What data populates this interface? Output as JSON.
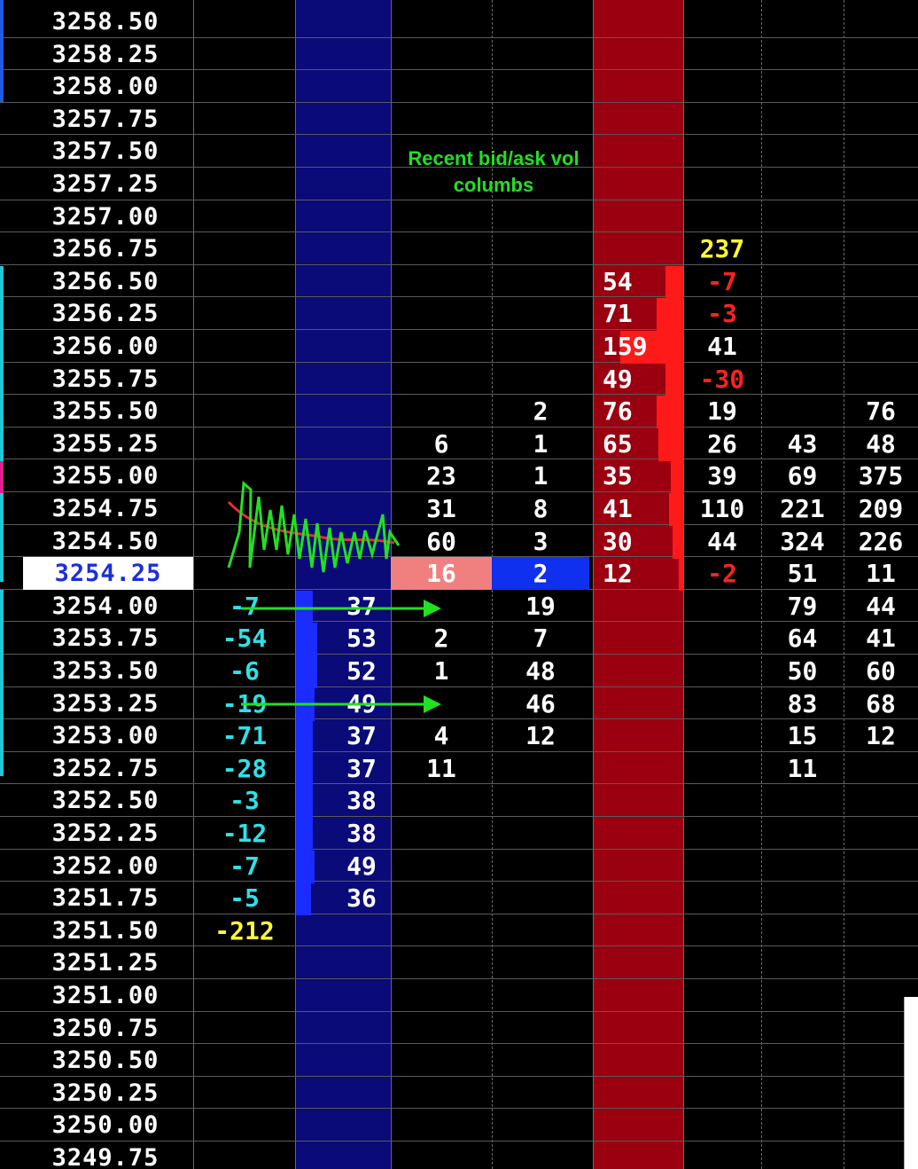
{
  "annotation": {
    "line1": "Recent bid/ask vol",
    "line2": "columbs"
  },
  "current_price": "3254.25",
  "rows": [
    {
      "price": "3258.50"
    },
    {
      "price": "3258.25"
    },
    {
      "price": "3258.00"
    },
    {
      "price": "3257.75"
    },
    {
      "price": "3257.50"
    },
    {
      "price": "3257.25"
    },
    {
      "price": "3257.00"
    },
    {
      "price": "3256.75",
      "delta_a": "237"
    },
    {
      "price": "3256.50",
      "ask": "54",
      "ask_fill": 0.2,
      "delta_a": "-7"
    },
    {
      "price": "3256.25",
      "ask": "71",
      "ask_fill": 0.3,
      "delta_a": "-3"
    },
    {
      "price": "3256.00",
      "ask": "159",
      "ask_fill": 0.7,
      "delta_a": "41"
    },
    {
      "price": "3255.75",
      "ask": "49",
      "ask_fill": 0.2,
      "delta_a": "-30"
    },
    {
      "price": "3255.50",
      "rec_ask": "2",
      "ask": "76",
      "ask_fill": 0.3,
      "delta_a": "19",
      "col_h": "76"
    },
    {
      "price": "3255.25",
      "rec_bid": "6",
      "rec_ask": "1",
      "ask": "65",
      "ask_fill": 0.28,
      "delta_a": "26",
      "col_g": "43",
      "col_h": "48"
    },
    {
      "price": "3255.00",
      "rec_bid": "23",
      "rec_ask": "1",
      "ask": "35",
      "ask_fill": 0.14,
      "delta_a": "39",
      "col_g": "69",
      "col_h": "375"
    },
    {
      "price": "3254.75",
      "rec_bid": "31",
      "rec_ask": "8",
      "ask": "41",
      "ask_fill": 0.16,
      "delta_a": "110",
      "col_g": "221",
      "col_h": "209"
    },
    {
      "price": "3254.50",
      "rec_bid": "60",
      "rec_ask": "3",
      "ask": "30",
      "ask_fill": 0.12,
      "delta_a": "44",
      "col_g": "324",
      "col_h": "226"
    },
    {
      "price": "3254.25",
      "current": true,
      "rec_bid": "16",
      "rec_ask": "2",
      "ask": "12",
      "ask_fill": 0.05,
      "delta_a": "-2",
      "col_g": "51",
      "col_h": "11"
    },
    {
      "price": "3254.00",
      "delta_b": "-7",
      "bid": "37",
      "bid_fill": 0.18,
      "rec_ask": "19",
      "col_g": "79",
      "col_h": "44"
    },
    {
      "price": "3253.75",
      "delta_b": "-54",
      "bid": "53",
      "bid_fill": 0.22,
      "rec_bid": "2",
      "rec_ask": "7",
      "col_g": "64",
      "col_h": "41"
    },
    {
      "price": "3253.50",
      "delta_b": "-6",
      "bid": "52",
      "bid_fill": 0.22,
      "rec_bid": "1",
      "rec_ask": "48",
      "col_g": "50",
      "col_h": "60"
    },
    {
      "price": "3253.25",
      "delta_b": "-19",
      "bid": "49",
      "bid_fill": 0.2,
      "rec_ask": "46",
      "col_g": "83",
      "col_h": "68"
    },
    {
      "price": "3253.00",
      "delta_b": "-71",
      "bid": "37",
      "bid_fill": 0.18,
      "rec_bid": "4",
      "rec_ask": "12",
      "col_g": "15",
      "col_h": "12"
    },
    {
      "price": "3252.75",
      "delta_b": "-28",
      "bid": "37",
      "bid_fill": 0.18,
      "rec_bid": "11",
      "col_g": "11"
    },
    {
      "price": "3252.50",
      "delta_b": "-3",
      "bid": "38",
      "bid_fill": 0.18
    },
    {
      "price": "3252.25",
      "delta_b": "-12",
      "bid": "38",
      "bid_fill": 0.18
    },
    {
      "price": "3252.00",
      "delta_b": "-7",
      "bid": "49",
      "bid_fill": 0.2
    },
    {
      "price": "3251.75",
      "delta_b": "-5",
      "bid": "36",
      "bid_fill": 0.16
    },
    {
      "price": "3251.50",
      "delta_b": "-212"
    },
    {
      "price": "3251.25"
    },
    {
      "price": "3251.00"
    },
    {
      "price": "3250.75"
    },
    {
      "price": "3250.50"
    },
    {
      "price": "3250.25"
    },
    {
      "price": "3250.00"
    },
    {
      "price": "3249.75"
    }
  ],
  "colors": {
    "bid_column_bg": "#0a0a78",
    "bid_bar": "#1a2cff",
    "ask_column_bg": "#9a0010",
    "ask_bar": "#ff1a1a",
    "recent_bid_highlight": "#f08080",
    "recent_ask_highlight": "#1030f0",
    "delta_bid_text": "#2de2e6",
    "delta_neg_text": "#ff2222",
    "total_text": "#ffff33",
    "annotation": "#22e022"
  }
}
